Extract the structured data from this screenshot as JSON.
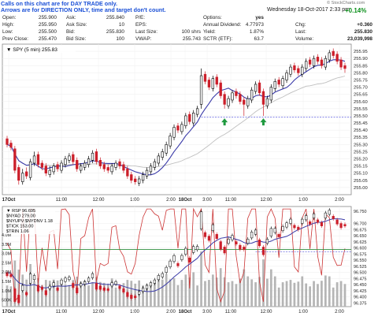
{
  "notes": {
    "line1": "Calls on this chart are for DAY TRADE only.",
    "line2": "Arrows are for DIRECTION ONLY, time and target don't count."
  },
  "header": {
    "datetime": "Wednesday  18-Oct-2017   2:33 pm",
    "change_pct": "+0.14%",
    "logo": "© StockCharts.com",
    "cells": [
      {
        "label": "Open:",
        "value": "255.900"
      },
      {
        "label": "High:",
        "value": "255.950"
      },
      {
        "label": "Low:",
        "value": "255.500"
      },
      {
        "label": "Prev Close:",
        "value": "255.470"
      },
      {
        "label": "Ask:",
        "value": "255.840"
      },
      {
        "label": "Ask Size:",
        "value": "10"
      },
      {
        "label": "Bid:",
        "value": "255.830"
      },
      {
        "label": "Bid Size:",
        "value": "100"
      },
      {
        "label": "P/E:",
        "value": ""
      },
      {
        "label": "EPS:",
        "value": ""
      },
      {
        "label": "Last Size:",
        "value": "100 shrs"
      },
      {
        "label": "VWAP:",
        "value": "255.743"
      },
      {
        "label": "Options:",
        "value": "yes"
      },
      {
        "label": "Annual Dividend:",
        "value": "4.77973"
      },
      {
        "label": "Yield:",
        "value": "1.87%"
      },
      {
        "label": "SCTR (ETF):",
        "value": "63.7"
      },
      {
        "label": "Chg:",
        "value": "+0.360"
      },
      {
        "label": "Last:",
        "value": "255.830"
      },
      {
        "label": "Volume:",
        "value": "23,039,998"
      }
    ]
  },
  "colors": {
    "up": "#000000",
    "down": "#cc1f2a",
    "ma": "#3a3aa8",
    "ma_slow": "#bfbfbf",
    "level": "#5555dd",
    "arrow": "#1f9a3f",
    "green_line": "#2e8f3e",
    "red_ind": "#cc3333",
    "vol": "#b5b5b5"
  },
  "chart_data": [
    {
      "type": "candlestick",
      "legend": "▼ SPY (5 min) 255.83",
      "ylim": [
        254.95,
        256.0
      ],
      "y_ticks": [
        "255.95",
        "255.90",
        "255.85",
        "255.80",
        "255.75",
        "255.70",
        "255.65",
        "255.60",
        "255.55",
        "255.50",
        "255.45",
        "255.40",
        "255.35",
        "255.30",
        "255.25",
        "255.20",
        "255.15",
        "255.10",
        "255.05",
        "255.00"
      ],
      "x_ticks": [
        "17Oct",
        "11:00",
        "12:00",
        "1:00",
        "2:00",
        "3:00",
        "18Oct",
        "11:00",
        "12:00",
        "1:00",
        "2:00",
        "3:00"
      ],
      "close": [
        255.3,
        255.28,
        255.12,
        255.05,
        255.1,
        255.08,
        255.18,
        255.22,
        255.16,
        255.14,
        255.1,
        255.12,
        255.15,
        255.13,
        255.17,
        255.2,
        255.22,
        255.18,
        255.13,
        255.15,
        255.17,
        255.2,
        255.24,
        255.18,
        255.15,
        255.13,
        255.12,
        255.15,
        255.17,
        255.15,
        255.12,
        255.08,
        255.05,
        255.04,
        255.06,
        255.09,
        255.12,
        255.15,
        255.18,
        255.22,
        255.25,
        255.3,
        255.36,
        255.42,
        255.4,
        255.44,
        255.5,
        255.46,
        255.52,
        255.55,
        255.78,
        255.74,
        255.7,
        255.76,
        255.72,
        255.64,
        255.58,
        255.62,
        255.66,
        255.64,
        255.6,
        255.58,
        255.62,
        255.68,
        255.72,
        255.66,
        255.58,
        255.62,
        255.7,
        255.74,
        255.72,
        255.76,
        255.8,
        255.84,
        255.82,
        255.8,
        255.84,
        255.88,
        255.86,
        255.9,
        255.88,
        255.85,
        255.9,
        255.94,
        255.92,
        255.88,
        255.84,
        255.83
      ],
      "open": [
        255.34,
        255.31,
        255.27,
        255.14,
        255.04,
        255.11,
        255.07,
        255.17,
        255.23,
        255.17,
        255.15,
        255.09,
        255.11,
        255.16,
        255.12,
        255.16,
        255.19,
        255.23,
        255.19,
        255.12,
        255.14,
        255.16,
        255.19,
        255.25,
        255.19,
        255.16,
        255.14,
        255.11,
        255.14,
        255.18,
        255.16,
        255.13,
        255.09,
        255.06,
        255.03,
        255.05,
        255.08,
        255.11,
        255.14,
        255.17,
        255.21,
        255.24,
        255.29,
        255.35,
        255.43,
        255.39,
        255.43,
        255.51,
        255.45,
        255.51,
        255.58,
        255.79,
        255.75,
        255.69,
        255.77,
        255.73,
        255.65,
        255.57,
        255.61,
        255.67,
        255.65,
        255.61,
        255.57,
        255.61,
        255.67,
        255.73,
        255.67,
        255.57,
        255.61,
        255.69,
        255.75,
        255.71,
        255.75,
        255.79,
        255.85,
        255.83,
        255.79,
        255.83,
        255.89,
        255.85,
        255.91,
        255.89,
        255.84,
        255.89,
        255.95,
        255.93,
        255.89,
        255.85
      ],
      "high": [
        255.36,
        255.33,
        255.29,
        255.16,
        255.13,
        255.14,
        255.2,
        255.25,
        255.25,
        255.19,
        255.17,
        255.15,
        255.17,
        255.18,
        255.19,
        255.22,
        255.24,
        255.25,
        255.21,
        255.17,
        255.19,
        255.22,
        255.26,
        255.27,
        255.21,
        255.18,
        255.16,
        255.17,
        255.19,
        255.2,
        255.18,
        255.15,
        255.11,
        255.08,
        255.08,
        255.11,
        255.14,
        255.17,
        255.2,
        255.24,
        255.27,
        255.32,
        255.38,
        255.44,
        255.45,
        255.46,
        255.52,
        255.53,
        255.54,
        255.57,
        255.83,
        255.81,
        255.77,
        255.78,
        255.79,
        255.75,
        255.67,
        255.64,
        255.68,
        255.69,
        255.67,
        255.63,
        255.64,
        255.7,
        255.74,
        255.75,
        255.69,
        255.64,
        255.72,
        255.76,
        255.77,
        255.78,
        255.82,
        255.86,
        255.87,
        255.85,
        255.86,
        255.9,
        255.91,
        255.92,
        255.93,
        255.91,
        255.92,
        255.96,
        255.97,
        255.95,
        255.91,
        255.87
      ],
      "low": [
        255.28,
        255.26,
        255.1,
        255.02,
        255.02,
        255.06,
        255.05,
        255.15,
        255.14,
        255.12,
        255.08,
        255.07,
        255.09,
        255.11,
        255.1,
        255.14,
        255.17,
        255.16,
        255.11,
        255.1,
        255.12,
        255.14,
        255.17,
        255.16,
        255.13,
        255.11,
        255.1,
        255.09,
        255.12,
        255.13,
        255.1,
        255.06,
        255.03,
        255.02,
        255.01,
        255.03,
        255.06,
        255.09,
        255.12,
        255.15,
        255.19,
        255.22,
        255.27,
        255.33,
        255.38,
        255.37,
        255.41,
        255.44,
        255.43,
        255.49,
        255.55,
        255.72,
        255.68,
        255.67,
        255.7,
        255.62,
        255.55,
        255.55,
        255.59,
        255.62,
        255.58,
        255.5,
        255.55,
        255.59,
        255.65,
        255.64,
        255.5,
        255.55,
        255.59,
        255.67,
        255.7,
        255.69,
        255.73,
        255.77,
        255.8,
        255.78,
        255.77,
        255.81,
        255.84,
        255.83,
        255.86,
        255.83,
        255.82,
        255.87,
        255.9,
        255.86,
        255.82,
        255.8
      ],
      "annotations": {
        "dotted_level": 255.49,
        "arrows": [
          255.51,
          255.51
        ]
      }
    },
    {
      "type": "line",
      "legends": [
        "▼ RSP 96.695",
        "$NYAD 279.00",
        "$NYUPV:$NYDNV 1.18",
        "$TICK 153.00",
        "$TRIN 1.06"
      ],
      "ylim": [
        96.36,
        96.77
      ],
      "y_ticks": [
        "96.750",
        "96.700",
        "96.675",
        "96.650",
        "96.625",
        "96.600",
        "96.575",
        "96.550",
        "96.525",
        "96.500",
        "96.475",
        "96.450",
        "96.425",
        "96.400",
        "96.375"
      ],
      "volume_ticks": [
        "4.0M",
        "3.5M",
        "3.0M",
        "2.5M",
        "2.0M",
        "1.5M",
        "1.0M",
        "500K"
      ],
      "x_ticks": [
        "17Oct",
        "11:00",
        "12:00",
        "1:00",
        "2:00",
        "3:00",
        "18Oct",
        "11:00",
        "12:00",
        "1:00",
        "2:00",
        "3:00"
      ]
    }
  ]
}
